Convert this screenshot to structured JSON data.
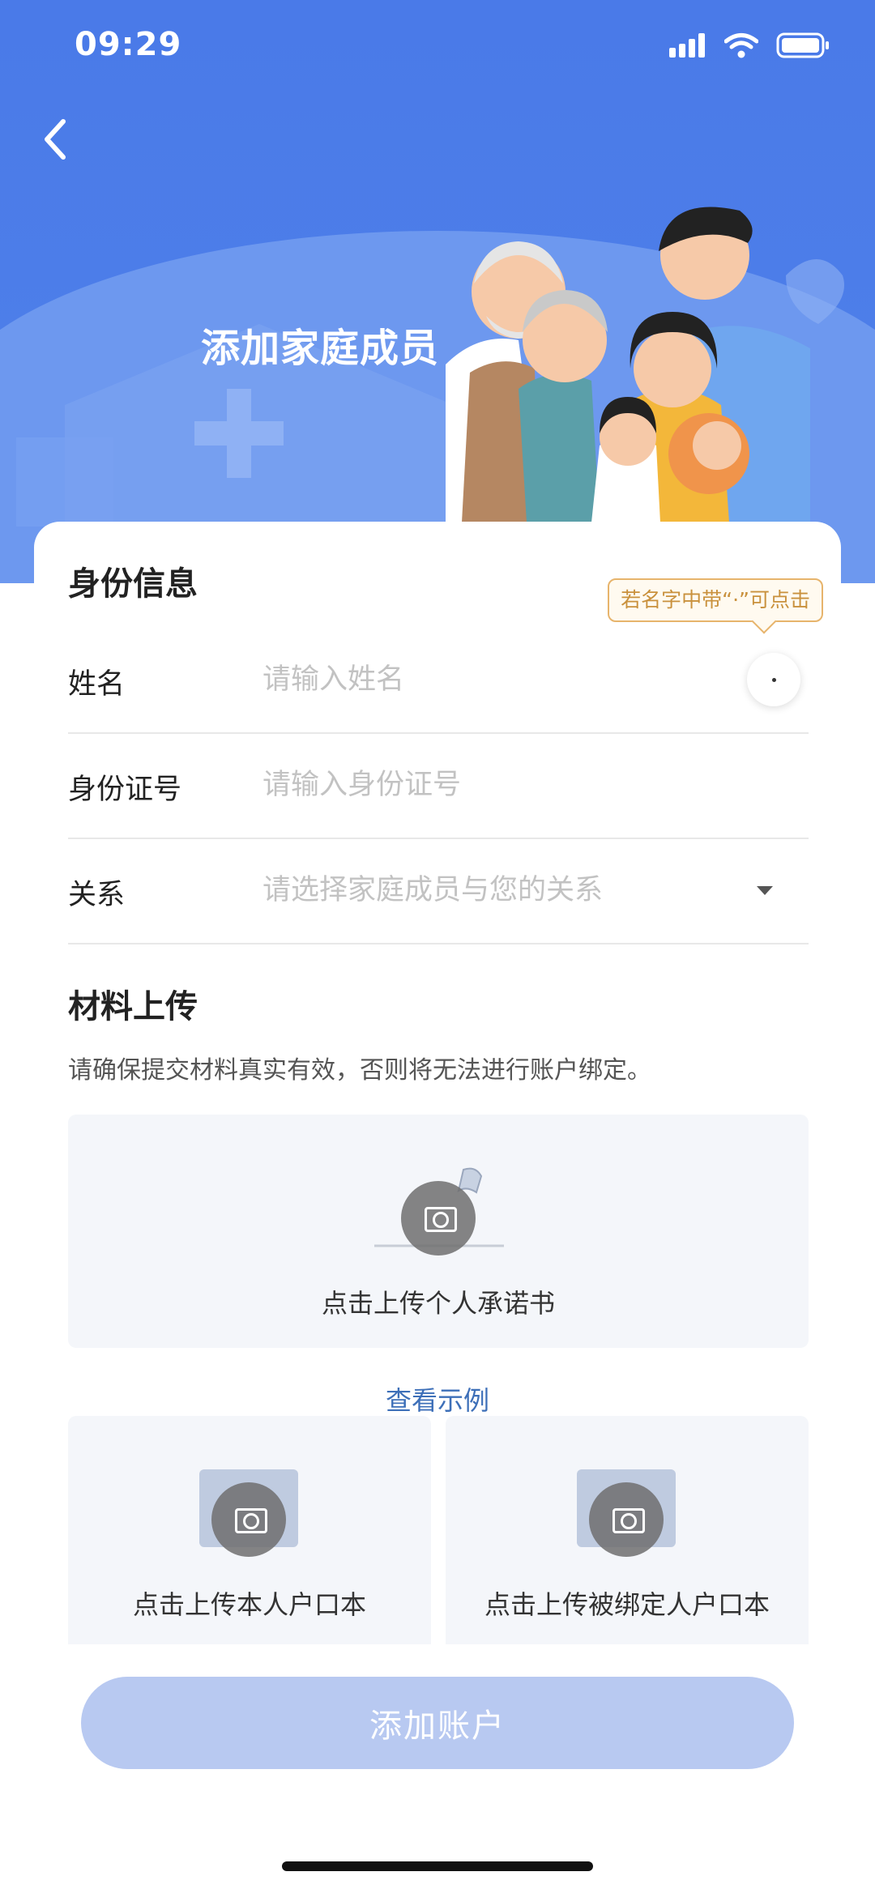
{
  "status_bar": {
    "time": "09:29"
  },
  "header": {
    "title": "添加家庭成员"
  },
  "identity": {
    "title": "身份信息",
    "tooltip": "若名字中带“·”可点击",
    "name_label": "姓名",
    "name_placeholder": "请输入姓名",
    "name_value": "",
    "id_label": "身份证号",
    "id_placeholder": "请输入身份证号",
    "id_value": "",
    "relation_label": "关系",
    "relation_placeholder": "请选择家庭成员与您的关系"
  },
  "materials": {
    "title": "材料上传",
    "note": "请确保提交材料真实有效，否则将无法进行账户绑定。",
    "upload_commitment": "点击上传个人承诺书",
    "view_example": "查看示例",
    "upload_own_hukou": "点击上传本人户口本",
    "upload_bound_hukou": "点击上传被绑定人户口本"
  },
  "footer": {
    "add_button": "添加账户"
  },
  "colors": {
    "brand_blue": "#4a7ae8",
    "button_disabled": "#b8c9f1",
    "tooltip_border": "#e7b46c",
    "link": "#3d6fb8"
  }
}
